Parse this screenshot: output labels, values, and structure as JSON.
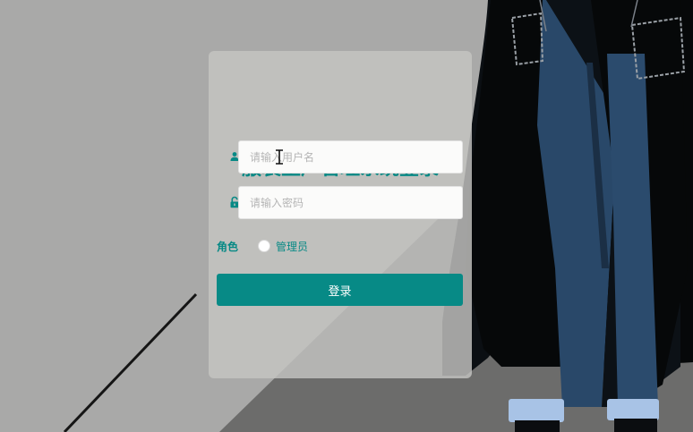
{
  "page": {
    "title": "服装生产管理系统登录"
  },
  "form": {
    "username_placeholder": "请输入用户名",
    "password_placeholder": "请输入密码",
    "role_label": "角色",
    "role_options": [
      {
        "label": "管理员",
        "selected": false
      }
    ],
    "submit_label": "登录"
  },
  "icons": {
    "username": "user-icon",
    "password": "lock-icon",
    "cursor": "text-cursor-icon"
  },
  "colors": {
    "accent": "#078985",
    "button": "#078a86",
    "panel": "#c4c4c2",
    "input_bg": "#fbfbfa"
  }
}
